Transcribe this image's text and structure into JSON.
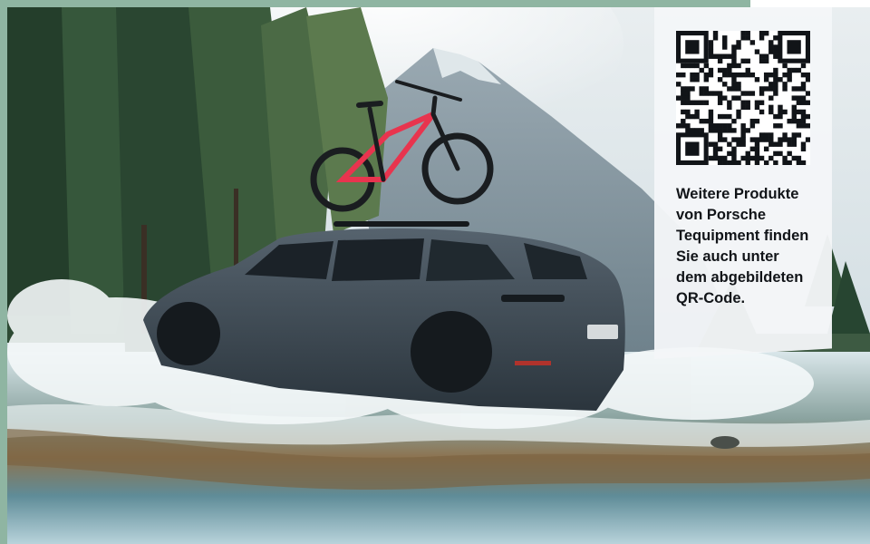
{
  "panel": {
    "lines": [
      "Weitere Produkte",
      "von Porsche",
      "Tequipment finden",
      "Sie auch unter",
      "dem abgebildeten",
      "QR-Code."
    ]
  },
  "colors": {
    "frame_accent": "#8fb5a2",
    "panel_background": "#f4f6f8",
    "panel_text": "#111418",
    "car_body": "#3d4a55",
    "bike_frame": "#e8344e"
  },
  "icons": {
    "qr": "qr-code-icon"
  }
}
